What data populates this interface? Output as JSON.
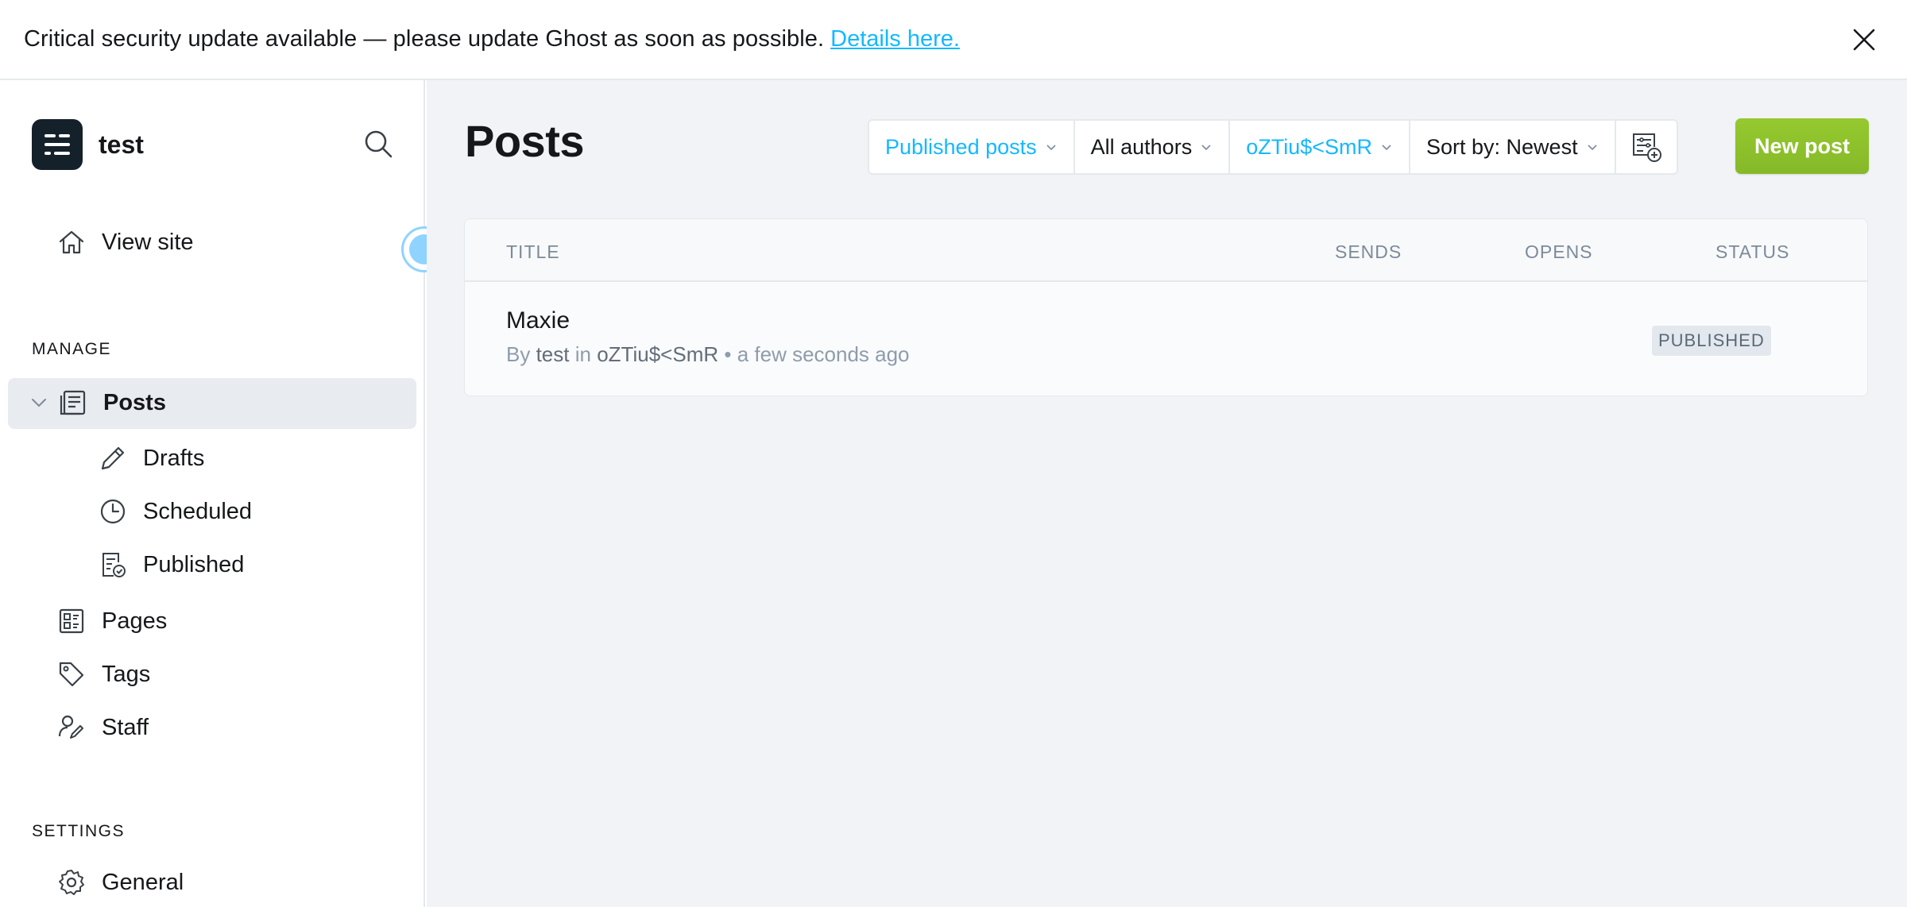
{
  "banner": {
    "message": "Critical security update available — please update Ghost as soon as possible.",
    "link": "Details here."
  },
  "sidebar": {
    "site_name": "test",
    "view_site": "View site",
    "manage_label": "MANAGE",
    "posts": "Posts",
    "drafts": "Drafts",
    "scheduled": "Scheduled",
    "published": "Published",
    "pages": "Pages",
    "tags": "Tags",
    "staff": "Staff",
    "settings_label": "SETTINGS",
    "general": "General"
  },
  "main": {
    "title": "Posts",
    "filters": {
      "type": "Published posts",
      "authors": "All authors",
      "tag": "oZTiu$<SmR",
      "sort": "Sort by: Newest"
    },
    "new_post": "New post",
    "table": {
      "headers": [
        "TITLE",
        "SENDS",
        "OPENS",
        "STATUS"
      ],
      "rows": [
        {
          "title": "Maxie",
          "by": "By",
          "author": "test",
          "in": "in",
          "tag": "oZTiu$<SmR",
          "time": "• a few seconds ago",
          "status": "PUBLISHED"
        }
      ]
    }
  },
  "colors": {
    "accent_blue": "#14b8ff",
    "primary_green": "#8dc22b",
    "sidebar_active": "#e8ebef"
  }
}
